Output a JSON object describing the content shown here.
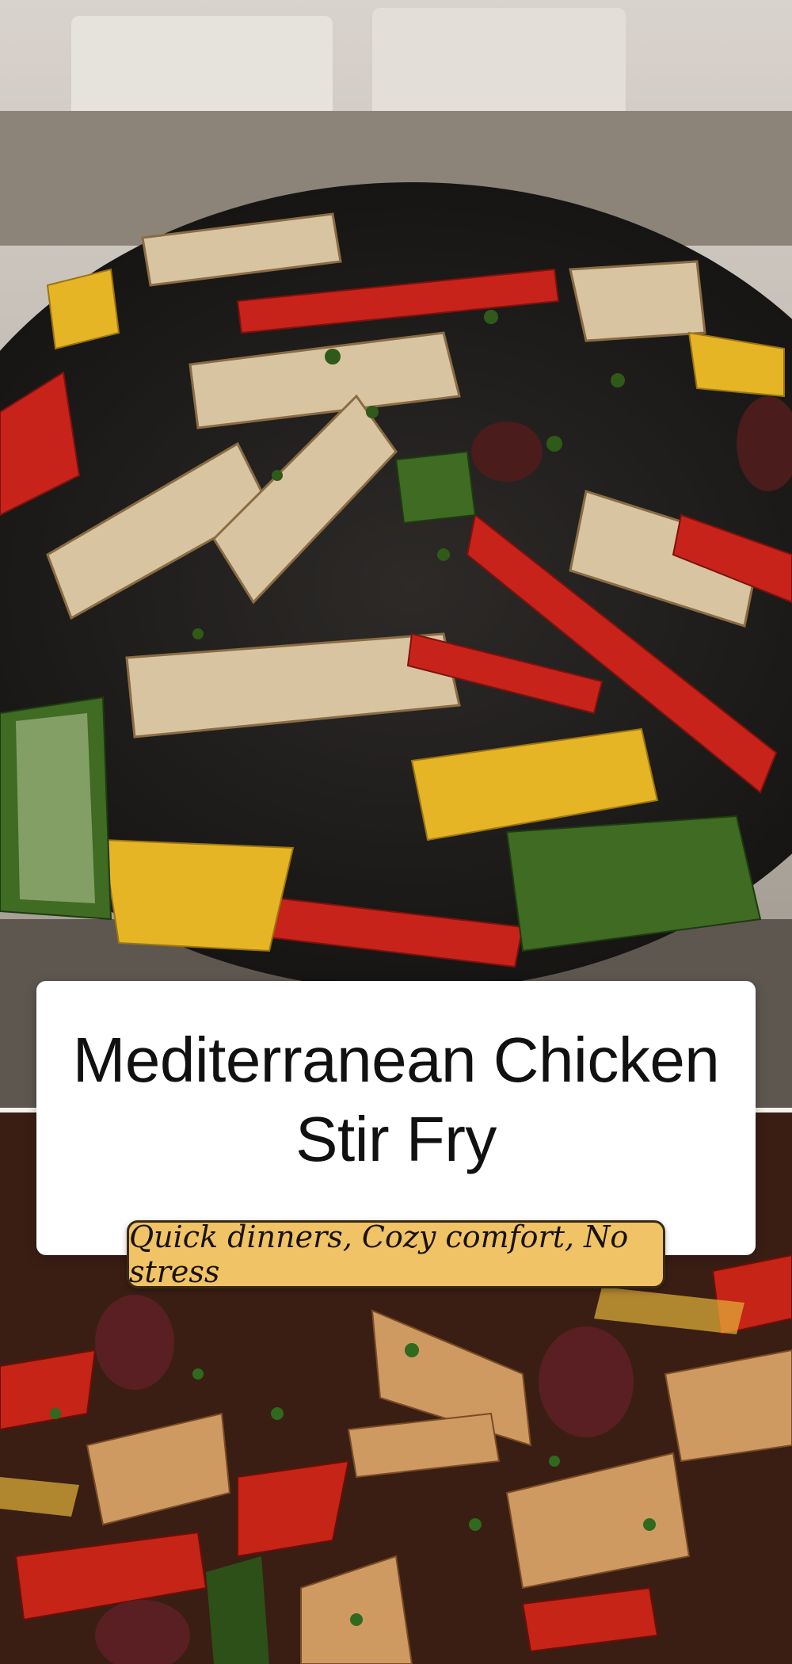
{
  "recipe": {
    "title": "Mediterranean Chicken Stir Fry",
    "tagline": "Quick dinners, Cozy comfort, No stress"
  },
  "images": {
    "top": "chicken stir fry with peppers and zucchini in dark speckled skillet",
    "bottom": "close-up of spiced chicken with peppers, onions and olives"
  },
  "colors": {
    "card_background": "#ffffff",
    "title_text": "#111111",
    "tagline_background": "#efc366",
    "tagline_border": "#3a2a14"
  }
}
